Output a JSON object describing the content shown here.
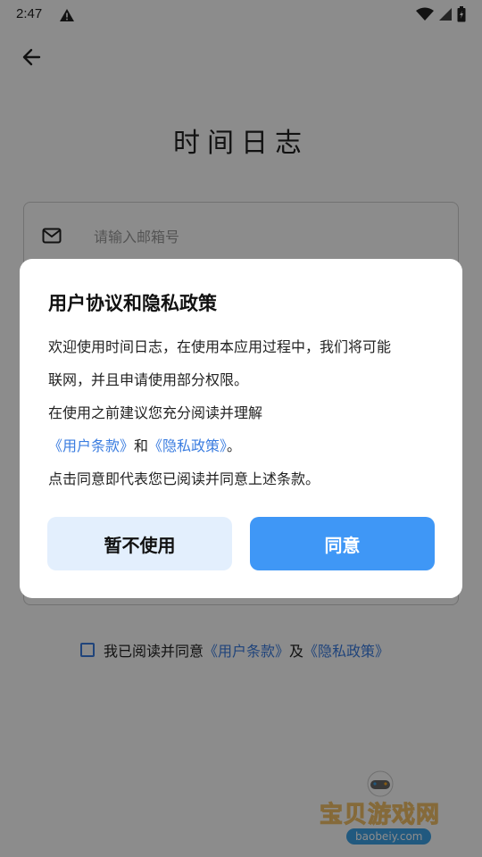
{
  "status": {
    "time": "2:47",
    "icons": [
      "warning-icon",
      "wifi-icon",
      "signal-icon",
      "battery-icon"
    ]
  },
  "header": {
    "back_icon": "arrow-left-icon"
  },
  "app": {
    "title": "时间日志"
  },
  "form": {
    "email_icon": "mail-icon",
    "email_placeholder": "请输入邮箱号",
    "email_value": ""
  },
  "agreement": {
    "prefix": "我已阅读并同意",
    "user_terms": "《用户条款》",
    "and": "及",
    "privacy": "《隐私政策》"
  },
  "dialog": {
    "title": "用户协议和隐私政策",
    "line1": "欢迎使用时间日志，在使用本应用过程中，我们将可能",
    "line2": "联网，并且申请使用部分权限。",
    "line3": "在使用之前建议您充分阅读并理解",
    "link_user_terms": "《用户条款》",
    "and": "和",
    "link_privacy": "《隐私政策》",
    "period": "。",
    "line5": "点击同意即代表您已阅读并同意上述条款。",
    "decline_label": "暂不使用",
    "agree_label": "同意"
  },
  "watermark": {
    "text": "宝贝游戏网",
    "url": "baobeiy.com"
  },
  "colors": {
    "accent": "#3f97f6",
    "link": "#3b7de0",
    "decline_bg": "#e3effd"
  }
}
